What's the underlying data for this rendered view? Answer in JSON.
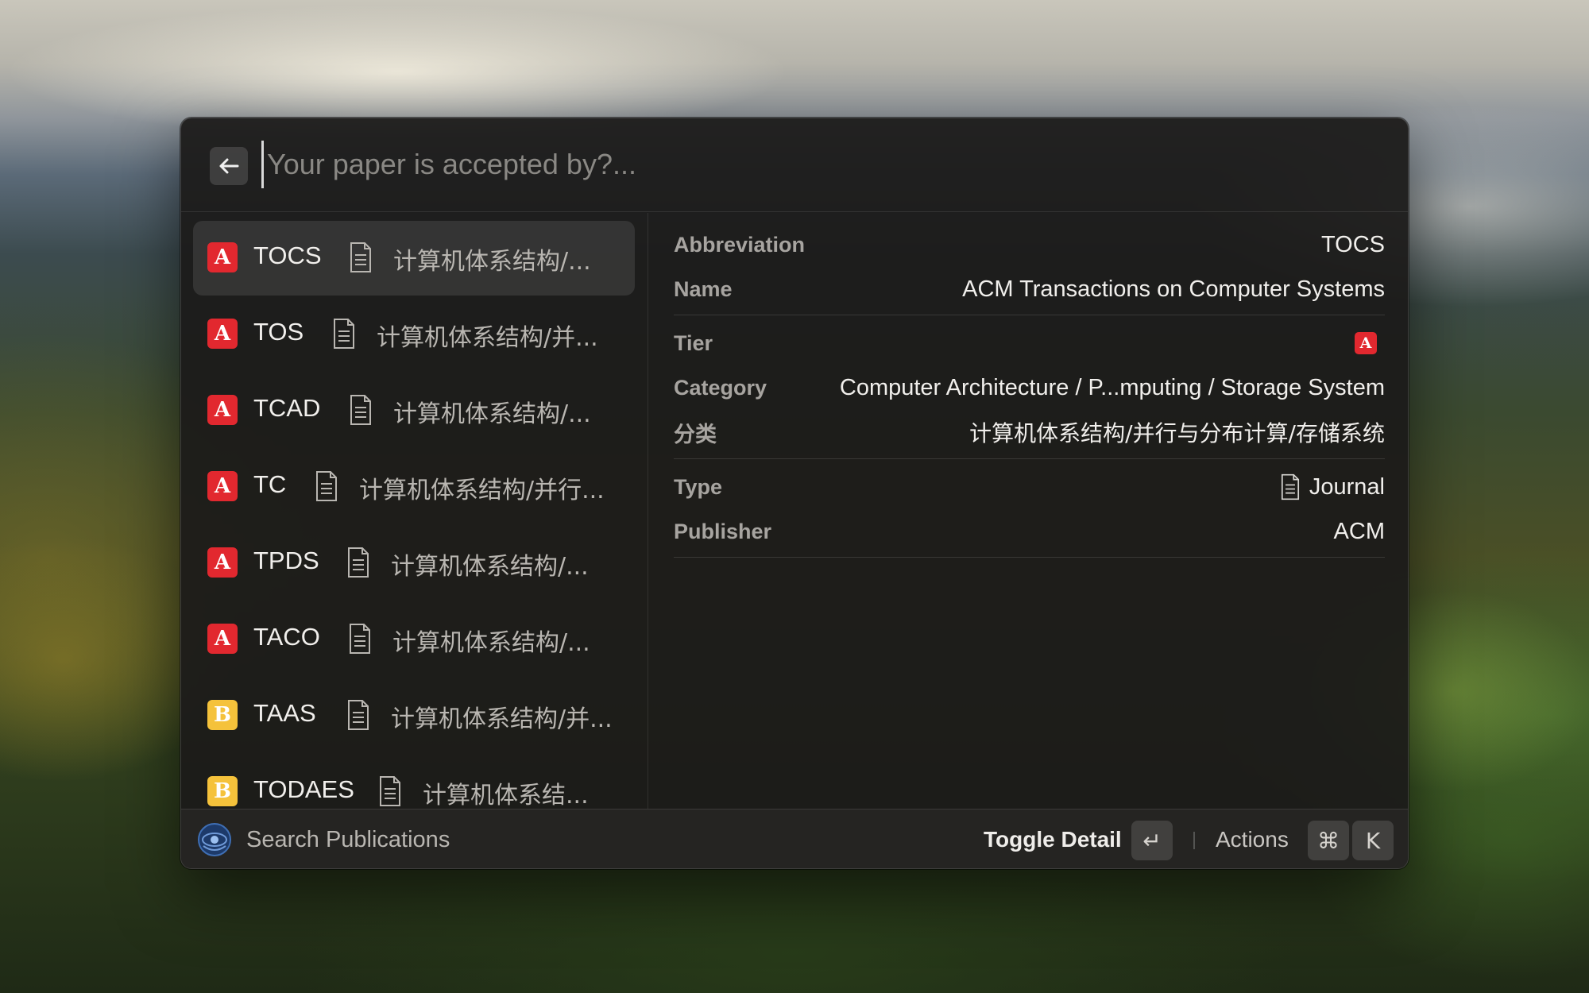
{
  "search": {
    "placeholder": "Your paper is accepted by?..."
  },
  "list": {
    "items": [
      {
        "abbr": "TOCS",
        "tier": "A",
        "category": "计算机体系结构/...",
        "selected": true
      },
      {
        "abbr": "TOS",
        "tier": "A",
        "category": "计算机体系结构/并..."
      },
      {
        "abbr": "TCAD",
        "tier": "A",
        "category": "计算机体系结构/..."
      },
      {
        "abbr": "TC",
        "tier": "A",
        "category": "计算机体系结构/并行..."
      },
      {
        "abbr": "TPDS",
        "tier": "A",
        "category": "计算机体系结构/..."
      },
      {
        "abbr": "TACO",
        "tier": "A",
        "category": "计算机体系结构/..."
      },
      {
        "abbr": "TAAS",
        "tier": "B",
        "category": "计算机体系结构/并..."
      },
      {
        "abbr": "TODAES",
        "tier": "B",
        "category": "计算机体系结..."
      }
    ]
  },
  "detail": {
    "abbreviation_label": "Abbreviation",
    "abbreviation_value": "TOCS",
    "name_label": "Name",
    "name_value": "ACM Transactions on Computer Systems",
    "tier_label": "Tier",
    "tier_value": "A",
    "category_label": "Category",
    "category_value": "Computer Architecture / P...mputing / Storage System",
    "category_zh_label": "分类",
    "category_zh_value": "计算机体系结构/并行与分布计算/存储系统",
    "type_label": "Type",
    "type_value": "Journal",
    "publisher_label": "Publisher",
    "publisher_value": "ACM"
  },
  "footer": {
    "title": "Search Publications",
    "primary_action": "Toggle Detail",
    "primary_key": "↵",
    "secondary_action": "Actions",
    "secondary_keys": [
      "⌘",
      "K"
    ]
  },
  "colors": {
    "tier_a": "#e2282f",
    "tier_b": "#f5c23b"
  }
}
